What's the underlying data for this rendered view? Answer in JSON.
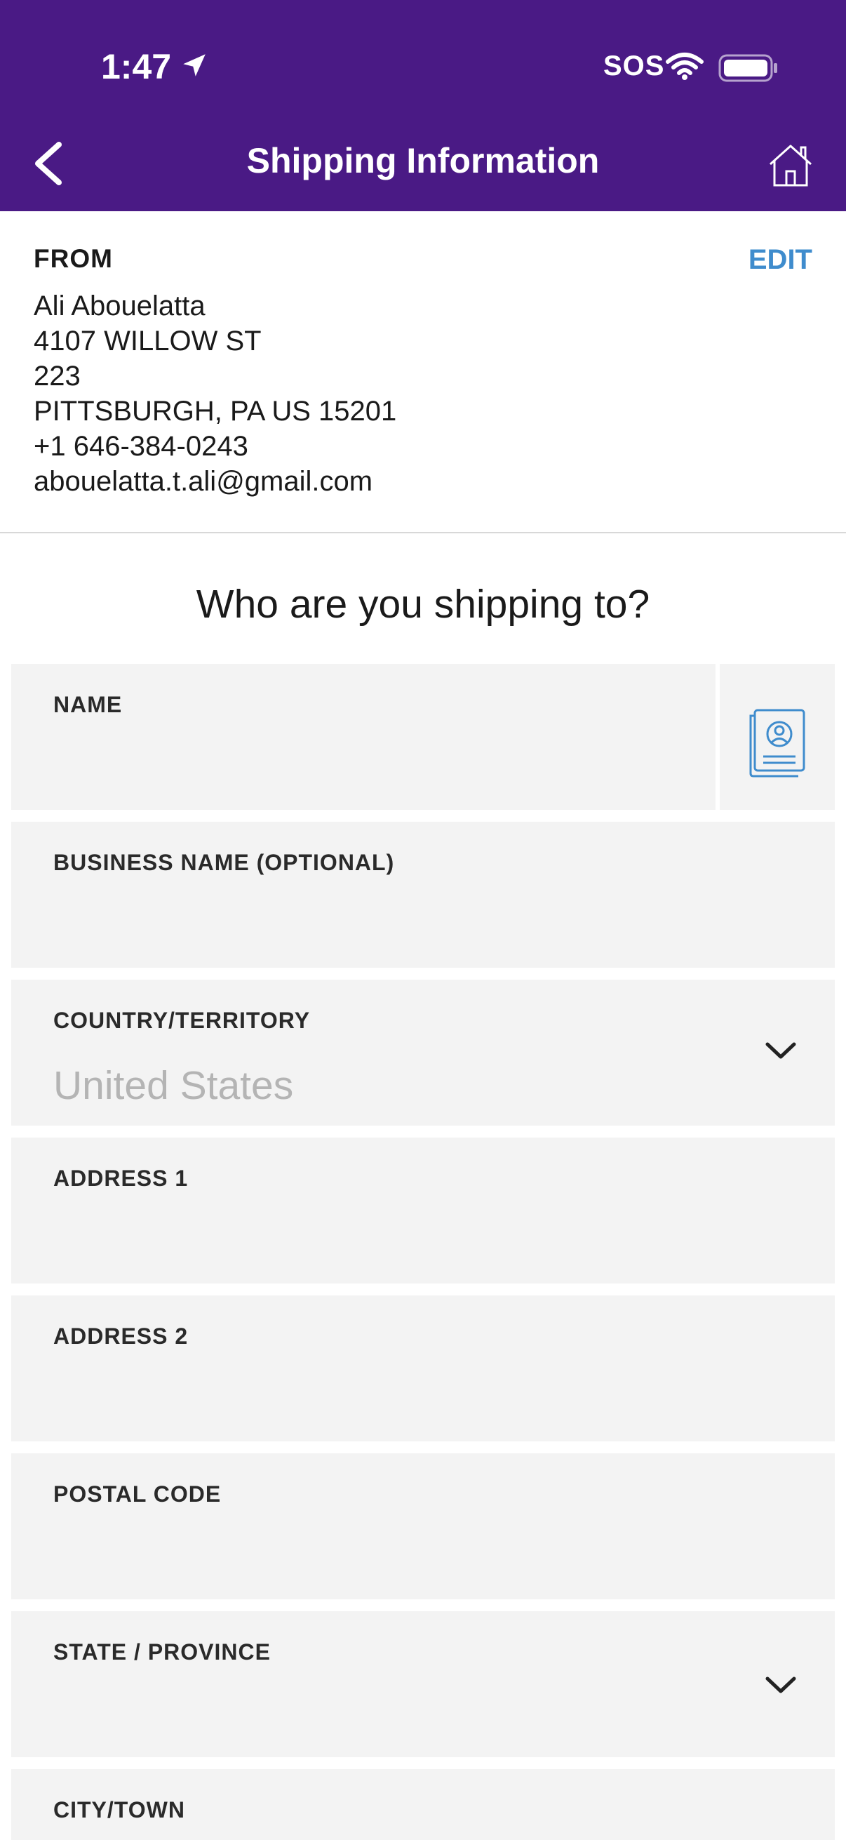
{
  "status_bar": {
    "time": "1:47",
    "sos": "SOS"
  },
  "nav": {
    "title": "Shipping Information"
  },
  "from": {
    "label": "FROM",
    "edit_label": "EDIT",
    "name": "Ali Abouelatta",
    "address1": "4107 WILLOW ST",
    "address2": "223",
    "city_line": "PITTSBURGH, PA US 15201",
    "phone": "+1 646-384-0243",
    "email": "abouelatta.t.ali@gmail.com"
  },
  "question": "Who are you shipping to?",
  "fields": {
    "name": {
      "label": "NAME"
    },
    "business": {
      "label": "BUSINESS NAME (OPTIONAL)"
    },
    "country": {
      "label": "COUNTRY/TERRITORY",
      "value": "United States"
    },
    "address1": {
      "label": "ADDRESS 1"
    },
    "address2": {
      "label": "ADDRESS 2"
    },
    "postal": {
      "label": "POSTAL CODE"
    },
    "state": {
      "label": "STATE / PROVINCE"
    },
    "city": {
      "label": "CITY/TOWN"
    }
  },
  "colors": {
    "header": "#4a1a85",
    "accent": "#3f8ccd",
    "field_bg": "#f3f3f3"
  },
  "icons": [
    "location-arrow-icon",
    "wifi-icon",
    "battery-icon",
    "back-chevron-icon",
    "home-icon",
    "address-book-icon",
    "chevron-down-icon"
  ]
}
